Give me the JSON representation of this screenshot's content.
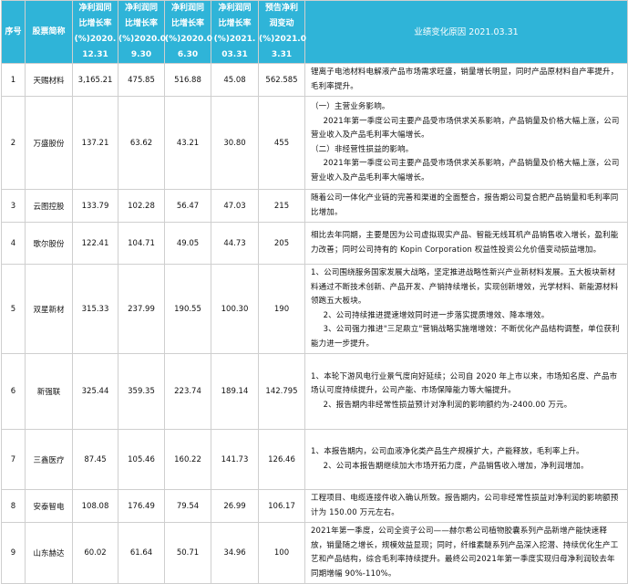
{
  "headers": {
    "seq": "序号",
    "name": "股票简称",
    "c1": [
      "净利润同",
      "比增长率",
      "(%)2020.",
      "12.31"
    ],
    "c2": [
      "净利润同",
      "比增长率",
      "(%)2020.0",
      "9.30"
    ],
    "c3": [
      "净利润同",
      "比增长率",
      "(%)2020.0",
      "6.30"
    ],
    "c4": [
      "净利润同",
      "比增长率",
      "(%)2021.",
      "03.31"
    ],
    "c5": [
      "预告净利",
      "润变动",
      "(%)2021.0",
      "3.31"
    ],
    "reason": "业绩变化原因 2021.03.31"
  },
  "rows": [
    {
      "seq": "1",
      "name": "天赐材料",
      "v1": "3,165.21",
      "v2": "475.85",
      "v3": "516.88",
      "v4": "45.08",
      "v5": "562.585",
      "reason": [
        "锂离子电池材料电解液产品市场需求旺盛，销量增长明显，同时产品原材料自产率提升，毛利率提升。"
      ]
    },
    {
      "seq": "2",
      "name": "万盛股份",
      "v1": "137.21",
      "v2": "63.62",
      "v3": "43.21",
      "v4": "30.80",
      "v5": "455",
      "reason": [
        "（一）主营业务影响。",
        "2021年第一季度公司主要产品受市场供求关系影响，产品销量及价格大幅上涨，公司营业收入及产品毛利率大幅增长。",
        "（二）非经营性损益的影响。",
        "2021年第一季度公司主要产品受市场供求关系影响，产品销量及价格大幅上涨，公司营业收入及产品毛利率大幅增长。"
      ]
    },
    {
      "seq": "3",
      "name": "云图控股",
      "v1": "133.79",
      "v2": "102.28",
      "v3": "56.47",
      "v4": "47.03",
      "v5": "215",
      "reason": [
        "随着公司一体化产业链的完善和渠道的全面整合，报告期公司复合肥产品销量和毛利率同比增加。"
      ]
    },
    {
      "seq": "4",
      "name": "歌尔股份",
      "v1": "122.41",
      "v2": "104.71",
      "v3": "49.05",
      "v4": "44.73",
      "v5": "205",
      "reason": [
        "相比去年同期，主要是因为公司虚拟现实产品、智能无线耳机产品销售收入增长，盈利能力改善；同时公司持有的 Kopin Corporation 权益性投资公允价值变动损益增加。"
      ]
    },
    {
      "seq": "5",
      "name": "双星新材",
      "v1": "315.33",
      "v2": "237.99",
      "v3": "190.55",
      "v4": "100.30",
      "v5": "190",
      "reason": [
        "1、公司围绕服务国家发展大战略，坚定推进战略性新兴产业新材料发展。五大板块新材料通过不断技术创新、产品开发、产销持续增长，实现创新增效，光学材料、新能源材料领跑五大板块。",
        "2、公司持续推进提速增效同时进一步落实提质增效、降本增效。",
        "3、公司强力推进\"三足鼎立\"营销战略实施增增效：不断优化产品结构调整，单位获利能力进一步提升。"
      ]
    },
    {
      "seq": "6",
      "name": "新强联",
      "v1": "325.44",
      "v2": "359.35",
      "v3": "223.74",
      "v4": "189.14",
      "v5": "142.795",
      "reason": [
        "1、本轮下游风电行业景气度向好延续；公司自 2020 年上市以来，市场知名度、产品市场认可度持续提升，公司产能、市场保障能力等大幅提升。",
        "2、报告期内非经常性损益预计对净利润的影响额约为-2400.00 万元。"
      ]
    },
    {
      "seq": "7",
      "name": "三鑫医疗",
      "v1": "87.45",
      "v2": "105.46",
      "v3": "160.22",
      "v4": "141.73",
      "v5": "126.46",
      "reason": [
        "1、本报告期内，公司血液净化类产品生产规模扩大，产能释放，毛利率上升。",
        "2、公司本报告期继续加大市场开拓力度，产品销售收入增加，净利润增加。"
      ]
    },
    {
      "seq": "8",
      "name": "安泰智电",
      "v1": "108.08",
      "v2": "176.49",
      "v3": "79.54",
      "v4": "26.99",
      "v5": "106.17",
      "reason": [
        "工程项目、电缆连接件收入确认所致。报告期内，公司非经常性损益对净利润的影响额预计为 150.00 万元左右。"
      ]
    },
    {
      "seq": "9",
      "name": "山东赫达",
      "v1": "60.02",
      "v2": "61.64",
      "v3": "50.71",
      "v4": "34.96",
      "v5": "100",
      "reason": [
        "2021年第一季度，公司全资子公司——赫尔希公司植物胶囊系列产品新增产能快速释放，销量随之增长，规模效益显现；同时，纤维素醚系列产品深入挖潜、持续优化生产工艺和产品结构，综合毛利率持续提升。最终公司2021年第一季度实现归母净利润较去年同期增幅 90%-110%。"
      ]
    }
  ]
}
